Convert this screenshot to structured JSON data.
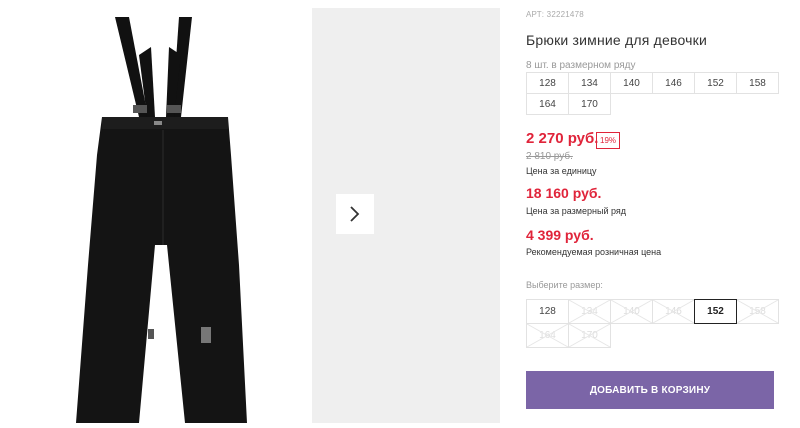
{
  "product": {
    "article_prefix": "АРТ:",
    "article": "32221478",
    "title": "Брюки зимние для девочки",
    "image_icon": "winter-trousers-image"
  },
  "gallery": {
    "next_icon": "chevron-right-icon"
  },
  "pack": {
    "note": "8 шт. в размерном ряду",
    "sizes": [
      "128",
      "134",
      "140",
      "146",
      "152",
      "158",
      "164",
      "170"
    ]
  },
  "prices": {
    "unit_price": "2 270 руб.",
    "discount": "19%",
    "old_price": "2 810 руб.",
    "unit_caption": "Цена за единицу",
    "range_price": "18 160 руб.",
    "range_caption": "Цена за размерный ряд",
    "rrp_price": "4 399 руб.",
    "rrp_caption": "Рекомендуемая розничная цена"
  },
  "size_select": {
    "label": "Выберите размер:",
    "options": [
      {
        "label": "128",
        "available": true,
        "selected": false
      },
      {
        "label": "134",
        "available": false,
        "selected": false
      },
      {
        "label": "140",
        "available": false,
        "selected": false
      },
      {
        "label": "146",
        "available": false,
        "selected": false
      },
      {
        "label": "152",
        "available": true,
        "selected": true
      },
      {
        "label": "158",
        "available": false,
        "selected": false
      },
      {
        "label": "164",
        "available": false,
        "selected": false
      },
      {
        "label": "170",
        "available": false,
        "selected": false
      }
    ]
  },
  "cart": {
    "add_label": "ДОБАВИТЬ В КОРЗИНУ"
  },
  "colors": {
    "accent": "#7b65a7",
    "price": "#e0243a",
    "thumb_bg": "#efefef"
  }
}
